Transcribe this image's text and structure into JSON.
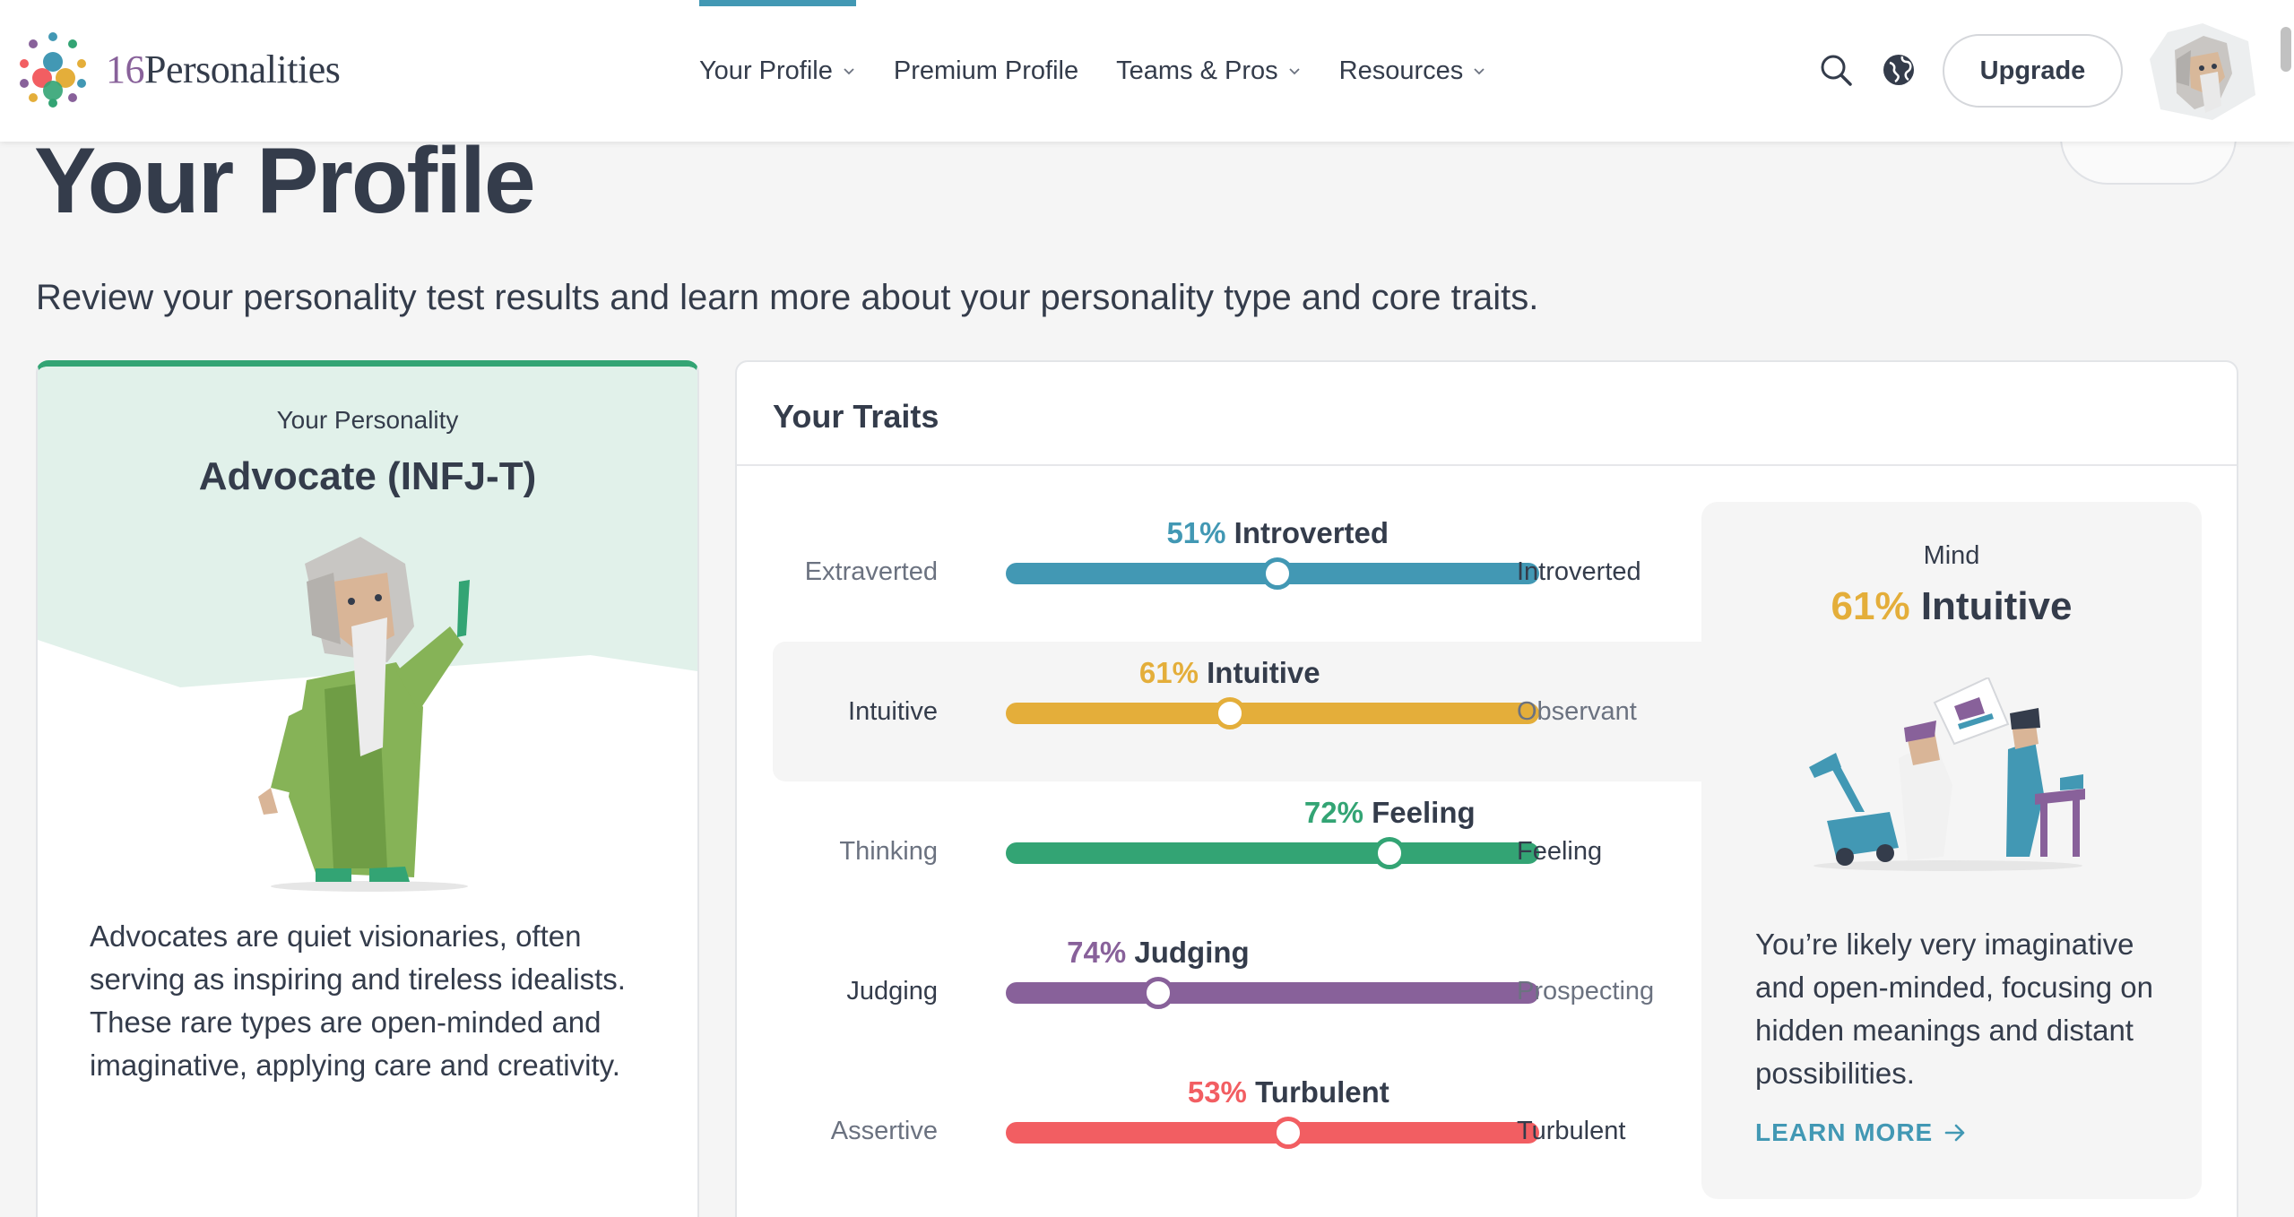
{
  "brand": {
    "logo_number": "16",
    "logo_word": "Personalities"
  },
  "nav": {
    "items": [
      {
        "label": "Your Profile",
        "dropdown": true,
        "active": true
      },
      {
        "label": "Premium Profile",
        "dropdown": false
      },
      {
        "label": "Teams & Pros",
        "dropdown": true
      },
      {
        "label": "Resources",
        "dropdown": true
      }
    ],
    "upgrade_label": "Upgrade"
  },
  "page": {
    "title": "Your Profile",
    "subtitle": "Review your personality test results and learn more about your personality type and core traits."
  },
  "personality": {
    "label": "Your Personality",
    "type": "Advocate (INFJ-T)",
    "description": "Advocates are quiet visionaries, often serving as inspiring and tireless idealists. These rare types are open-minded and imaginative, applying care and creativity.",
    "accent": "#33a474"
  },
  "traits": {
    "title": "Your Traits",
    "items": [
      {
        "pct": "51%",
        "name": "Introverted",
        "left": "Extraverted",
        "right": "Introverted",
        "position": 0.51,
        "color": "#4298b4",
        "strong": "right"
      },
      {
        "pct": "61%",
        "name": "Intuitive",
        "left": "Intuitive",
        "right": "Observant",
        "position": 0.42,
        "color": "#e4ae3a",
        "strong": "left"
      },
      {
        "pct": "72%",
        "name": "Feeling",
        "left": "Thinking",
        "right": "Feeling",
        "position": 0.72,
        "color": "#33a474",
        "strong": "right"
      },
      {
        "pct": "74%",
        "name": "Judging",
        "left": "Judging",
        "right": "Prospecting",
        "position": 0.286,
        "color": "#88619a",
        "strong": "left"
      },
      {
        "pct": "53%",
        "name": "Turbulent",
        "left": "Assertive",
        "right": "Turbulent",
        "position": 0.53,
        "color": "#f25e62",
        "strong": "right"
      }
    ]
  },
  "mind_panel": {
    "label": "Mind",
    "pct": "61%",
    "name": "Intuitive",
    "color": "#e4ae3a",
    "description": "You’re likely very imaginative and open-minded, focusing on hidden meanings and distant possibilities.",
    "link_label": "LEARN MORE"
  }
}
